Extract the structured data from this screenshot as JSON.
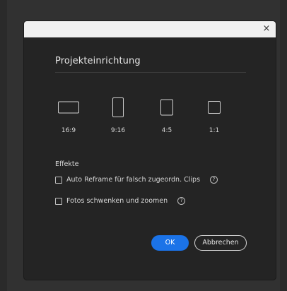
{
  "dialog": {
    "close_glyph": "×",
    "heading": "Projekteinrichtung",
    "aspect_ratios": [
      {
        "label": "16:9"
      },
      {
        "label": "9:16"
      },
      {
        "label": "4:5"
      },
      {
        "label": "1:1"
      }
    ],
    "effects": {
      "title": "Effekte",
      "options": [
        {
          "label": "Auto Reframe für falsch zugeordn. Clips",
          "checked": false,
          "help": "?"
        },
        {
          "label": "Fotos schwenken und zoomen",
          "checked": false,
          "help": "?"
        }
      ]
    },
    "buttons": {
      "ok": "OK",
      "cancel": "Abbrechen"
    }
  },
  "colors": {
    "accent": "#1b73e8",
    "dialog_bg": "#242424",
    "titlebar_bg": "#f0f0f0"
  }
}
